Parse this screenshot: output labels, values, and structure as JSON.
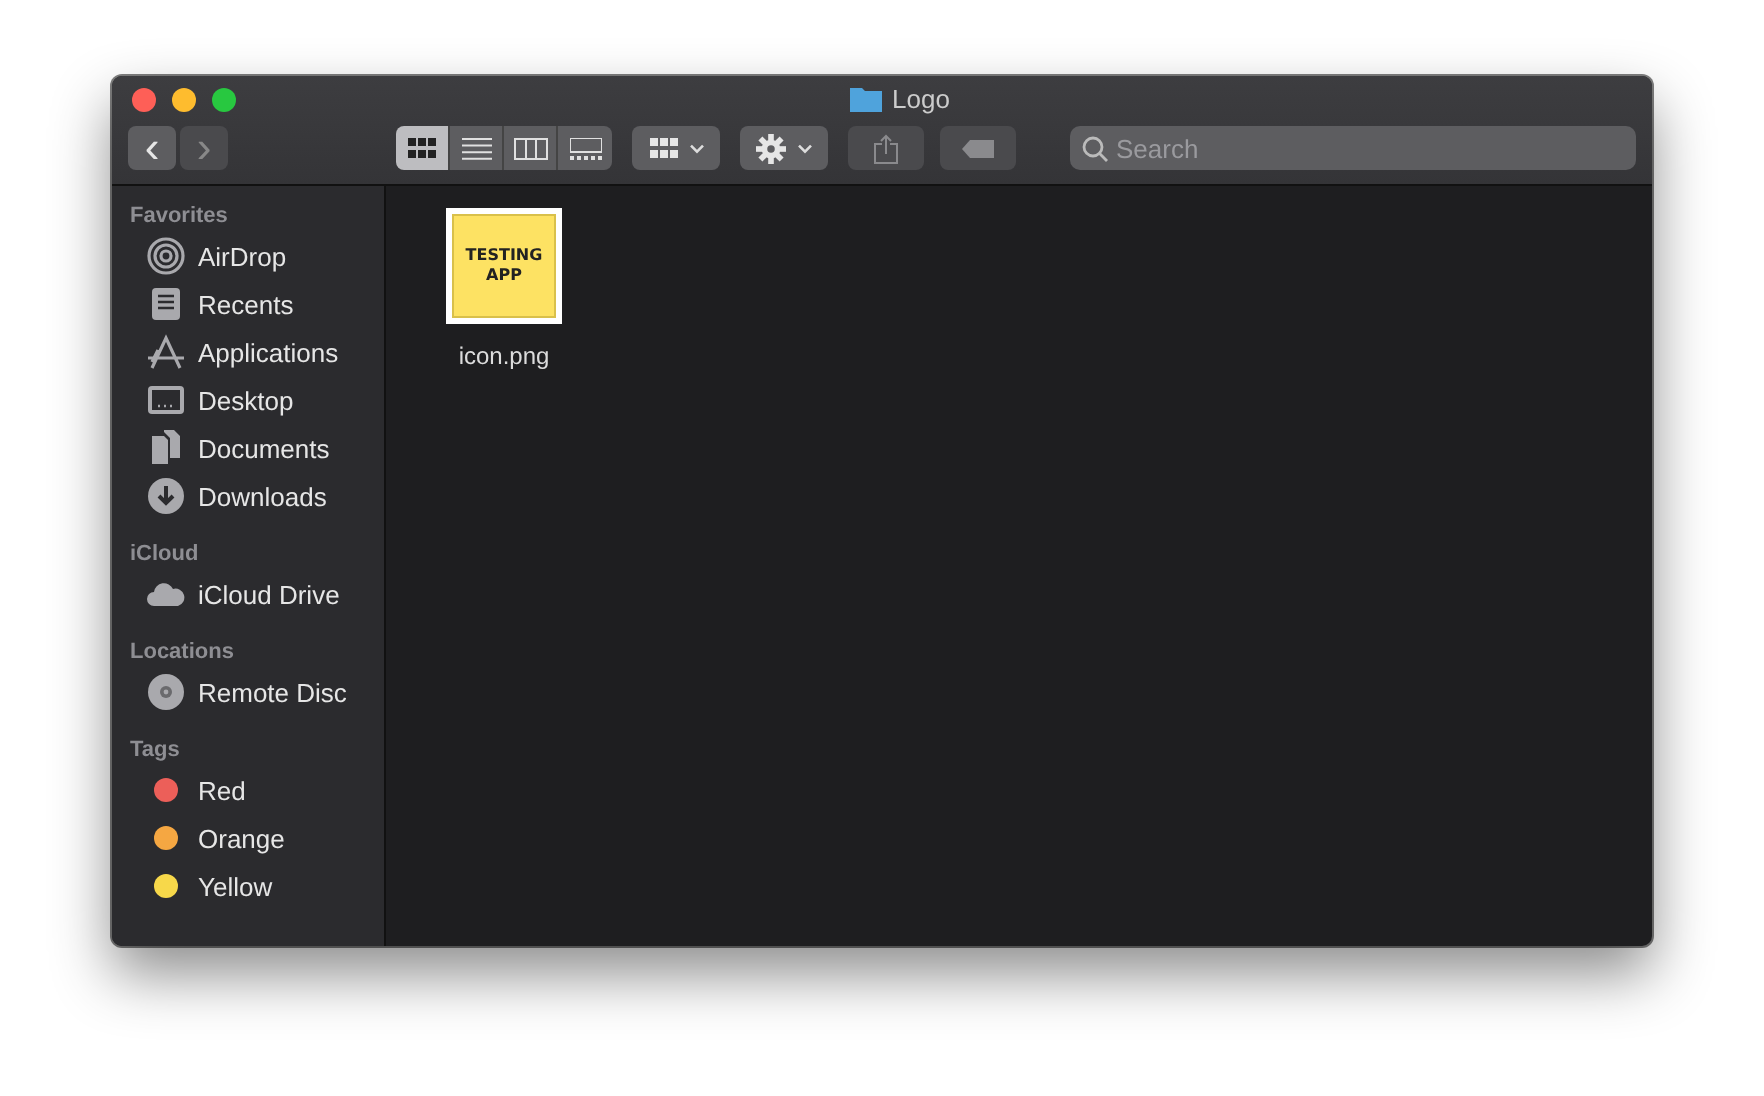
{
  "window": {
    "title": "Logo"
  },
  "toolbar": {
    "back": {
      "label": "‹",
      "disabled": false
    },
    "forward": {
      "label": "›",
      "disabled": true
    },
    "view_modes": [
      {
        "kind": "icons",
        "selected": true
      },
      {
        "kind": "list",
        "selected": false
      },
      {
        "kind": "columns",
        "selected": false
      },
      {
        "kind": "gallery",
        "selected": false
      }
    ],
    "share": {
      "disabled": true
    },
    "tags": {
      "disabled": true
    },
    "search": {
      "placeholder": "Search"
    }
  },
  "sidebar": [
    {
      "title": "Favorites",
      "items": [
        {
          "label": "AirDrop",
          "kind": "airdrop"
        },
        {
          "label": "Recents",
          "kind": "recents"
        },
        {
          "label": "Applications",
          "kind": "applications"
        },
        {
          "label": "Desktop",
          "kind": "desktop"
        },
        {
          "label": "Documents",
          "kind": "documents"
        },
        {
          "label": "Downloads",
          "kind": "downloads"
        }
      ]
    },
    {
      "title": "iCloud",
      "items": [
        {
          "label": "iCloud Drive",
          "kind": "cloud"
        }
      ]
    },
    {
      "title": "Locations",
      "items": [
        {
          "label": "Remote Disc",
          "kind": "disc"
        }
      ]
    },
    {
      "title": "Tags",
      "items": [
        {
          "label": "Red",
          "kind": "tag",
          "color": "#ec5f59"
        },
        {
          "label": "Orange",
          "kind": "tag",
          "color": "#f5a742"
        },
        {
          "label": "Yellow",
          "kind": "tag",
          "color": "#f7d84a"
        }
      ]
    }
  ],
  "files": [
    {
      "name": "icon.png",
      "thumbnail_text": "TESTING APP"
    }
  ]
}
